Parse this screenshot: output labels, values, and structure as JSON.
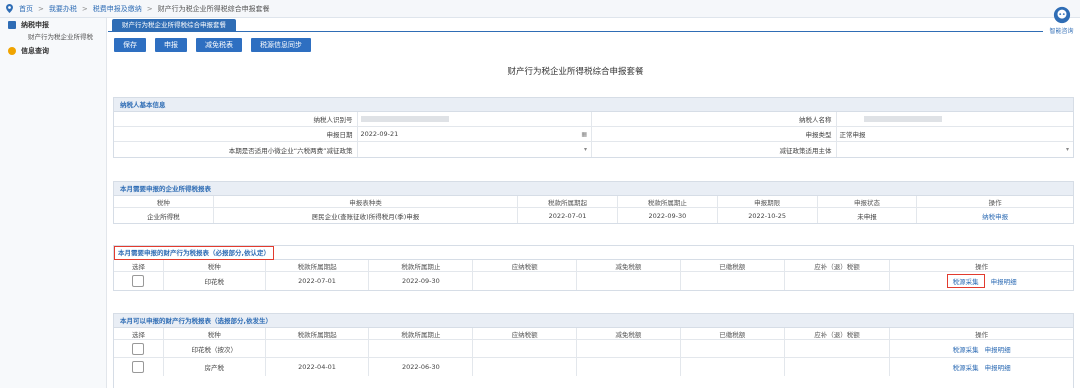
{
  "breadcrumb": {
    "items": [
      "首页",
      "我要办税",
      "税费申报及缴纳",
      "财产行为税企业所得税综合申报套餐"
    ],
    "sep": ">"
  },
  "sidebar": {
    "sections": [
      {
        "label": "纳税申报",
        "color": "#2f6db5",
        "subs": [
          "财产行为税企业所得税"
        ]
      },
      {
        "label": "信息查询",
        "color": "#f0a400",
        "subs": []
      }
    ]
  },
  "tab": {
    "label": "财产行为税企业所得税综合申报套餐"
  },
  "toolbar": {
    "buttons": [
      "保存",
      "申报",
      "减免税表",
      "税源信息同步"
    ]
  },
  "page_title": "财产行为税企业所得税综合申报套餐",
  "assistant": {
    "label": "智能咨询"
  },
  "basic": {
    "title": "纳税人基本信息",
    "id_label": "纳税人识别号",
    "name_label": "纳税人名称",
    "date_label": "申报日期",
    "date_value": "2022-09-21",
    "type_label": "申报类型",
    "type_value": "正常申报",
    "policy_label": "本期是否适用小微企业“六税两费”减征政策",
    "subject_label": "减征政策适用主体"
  },
  "cit": {
    "title": "本月需要申报的企业所得税报表",
    "headers": [
      "税种",
      "申报表种类",
      "税款所属期起",
      "税款所属期止",
      "申报期限",
      "申报状态",
      "操作"
    ],
    "rows": [
      [
        "企业所得税",
        "居民企业(查账征收)所得税月(季)申报",
        "2022-07-01",
        "2022-09-30",
        "2022-10-25",
        "未申报",
        "纳税申报"
      ]
    ]
  },
  "req": {
    "title": "本月需要申报的财产行为税报表（必报部分,依认定）",
    "headers": [
      "选择",
      "税种",
      "税款所属期起",
      "税款所属期止",
      "应纳税额",
      "减免税额",
      "已缴税额",
      "应补（退）税额",
      "操作"
    ],
    "rows": [
      {
        "tax": "印花税",
        "start": "2022-07-01",
        "end": "2022-09-30",
        "op1": "税源采集",
        "op2": "申报明细"
      }
    ]
  },
  "opt": {
    "title": "本月可以申报的财产行为税报表（选报部分,依发生）",
    "headers": [
      "选择",
      "税种",
      "税款所属期起",
      "税款所属期止",
      "应纳税额",
      "减免税额",
      "已缴税额",
      "应补（退）税额",
      "操作"
    ],
    "rows": [
      {
        "tax": "印花税（按次）",
        "start": "",
        "end": "",
        "op1": "税源采集",
        "op2": "申报明细"
      },
      {
        "tax": "房产税",
        "start": "2022-04-01",
        "end": "2022-06-30",
        "op1": "税源采集",
        "op2": "申报明细"
      }
    ]
  }
}
